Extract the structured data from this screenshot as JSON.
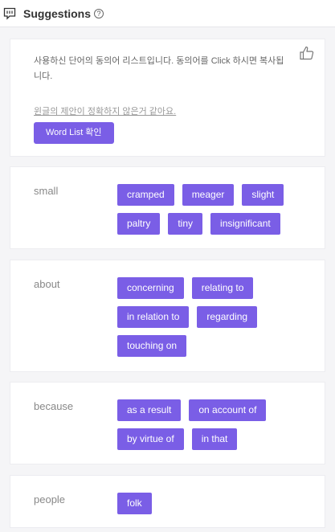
{
  "header": {
    "title": "Suggestions",
    "help_glyph": "?"
  },
  "intro": {
    "message": "사용하신 단어의 동의어 리스트입니다. 동의어를 Click 하시면 복사됩니다.",
    "feedback_link": "윈글의 제안이 정확하지 않은거 같아요.",
    "word_list_button": "Word List 확인"
  },
  "groups": [
    {
      "word": "small",
      "synonyms": [
        "cramped",
        "meager",
        "slight",
        "paltry",
        "tiny",
        "insignificant"
      ]
    },
    {
      "word": "about",
      "synonyms": [
        "concerning",
        "relating to",
        "in relation to",
        "regarding",
        "touching on"
      ]
    },
    {
      "word": "because",
      "synonyms": [
        "as a result",
        "on account of",
        "by virtue of",
        "in that"
      ]
    },
    {
      "word": "people",
      "synonyms": [
        "folk"
      ]
    }
  ],
  "colors": {
    "accent": "#7a5ee6"
  }
}
